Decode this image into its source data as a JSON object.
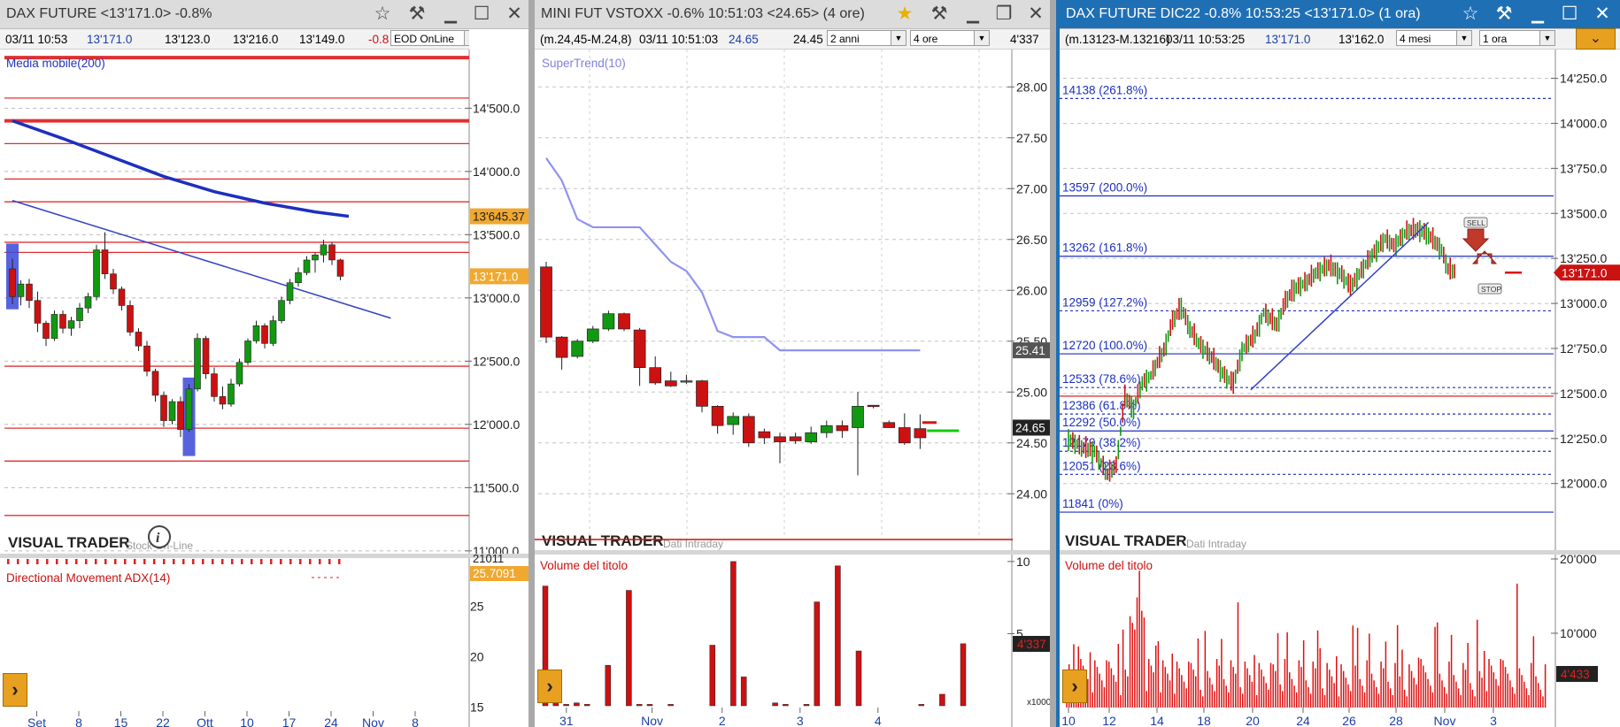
{
  "colors": {
    "up": "#119911",
    "down": "#cc1111",
    "ma": "#1d2fbf",
    "trend": "#3340c8",
    "supertrend": "#8f92f0",
    "fib": "#1d2fbf",
    "hline": "#e03030"
  },
  "panels": [
    {
      "title": "DAX FUTURE <13'171.0> -0.8%",
      "info": {
        "date": "03/11 10:53",
        "last": "13'171.0",
        "low": "13'123.0",
        "high": "13'216.0",
        "prev": "13'149.0",
        "change": "-0.8",
        "source": "EOD OnLine"
      },
      "indicator": "Media mobile(200)",
      "lower_indicator": "Directional Movement ADX(14)",
      "adx_value": "21011",
      "watermark": "VISUAL TRADER",
      "watermark_sub": "Stock On-Line",
      "price_labels": {
        "ma": "13'645.37",
        "last": "13'171.0",
        "adx": "25.7091"
      },
      "icons": [
        "star-icon",
        "tool-icon",
        "minimize-icon",
        "maximize-icon",
        "close-icon",
        "info-icon",
        "play-icon"
      ]
    },
    {
      "title": "MINI FUT VSTOXX -0.6% 10:51:03 <24.65> (4 ore)",
      "info": {
        "range": "(m.24,45-M.24,8)",
        "date": "03/11 10:51:03",
        "last": "24.65",
        "prev": "24.45",
        "period": "2 anni",
        "interval": "4 ore",
        "volume": "4'337"
      },
      "indicator": "SuperTrend(10)",
      "lower_indicator": "Volume del titolo",
      "watermark": "VISUAL TRADER",
      "watermark_sub": "Dati Intraday",
      "price_labels": {
        "st": "25.41",
        "last": "24.65",
        "vol": "4'337",
        "x1000": "x1000"
      },
      "icons": [
        "star-icon",
        "tool-icon",
        "minimize-icon",
        "restore-icon",
        "close-icon",
        "play-icon"
      ]
    },
    {
      "title": "DAX FUTURE DIC22 -0.8% 10:53:25 <13'171.0> (1 ora)",
      "info": {
        "range": "(m.13123-M.13216)",
        "date": "03/11 10:53:25",
        "last": "13'171.0",
        "prev": "13'162.0",
        "period": "4 mesi",
        "interval": "1 ora"
      },
      "lower_indicator": "Volume del titolo",
      "watermark": "VISUAL TRADER",
      "watermark_sub": "Dati Intraday",
      "price_labels": {
        "last": "13'171.0",
        "vol": "4'433"
      },
      "signals": {
        "sell": "SELL",
        "stop": "STOP"
      },
      "icons": [
        "star-icon",
        "tool-icon",
        "minimize-icon",
        "maximize-icon",
        "close-icon",
        "collapse-icon",
        "play-icon"
      ]
    }
  ],
  "chart_data": [
    {
      "type": "candlestick",
      "title": "DAX FUTURE <13'171.0> -0.8%",
      "ylim": [
        10950,
        14950
      ],
      "yticks": [
        "11'000.0",
        "11'500.0",
        "12'000.0",
        "12'500.0",
        "13'000.0",
        "13'500.0",
        "14'000.0",
        "14'500.0"
      ],
      "ytick_values": [
        11000,
        11500,
        12000,
        12500,
        13000,
        13500,
        14000,
        14500
      ],
      "xticks": [
        "Set",
        "8",
        "15",
        "22",
        "Ott",
        "10",
        "17",
        "24",
        "Nov",
        "8"
      ],
      "xtick_index": [
        5,
        10,
        15,
        20,
        25,
        30,
        35,
        40,
        45,
        50
      ],
      "candles": [
        [
          13230,
          13310,
          12950,
          13010
        ],
        [
          13010,
          13140,
          12940,
          13110
        ],
        [
          13110,
          13150,
          12920,
          12980
        ],
        [
          12980,
          13050,
          12730,
          12800
        ],
        [
          12800,
          12820,
          12620,
          12680
        ],
        [
          12680,
          12900,
          12660,
          12870
        ],
        [
          12870,
          12900,
          12720,
          12760
        ],
        [
          12760,
          12850,
          12700,
          12820
        ],
        [
          12820,
          12960,
          12760,
          12920
        ],
        [
          12920,
          13040,
          12880,
          13010
        ],
        [
          13010,
          13420,
          12980,
          13380
        ],
        [
          13380,
          13520,
          13150,
          13190
        ],
        [
          13190,
          13230,
          13030,
          13070
        ],
        [
          13070,
          13090,
          12900,
          12940
        ],
        [
          12940,
          12980,
          12700,
          12730
        ],
        [
          12730,
          12760,
          12580,
          12620
        ],
        [
          12620,
          12660,
          12380,
          12420
        ],
        [
          12420,
          12440,
          12180,
          12230
        ],
        [
          12230,
          12260,
          11980,
          12030
        ],
        [
          12030,
          12200,
          12000,
          12180
        ],
        [
          12180,
          12220,
          11900,
          11960
        ],
        [
          11960,
          12320,
          11940,
          12280
        ],
        [
          12280,
          12720,
          12260,
          12680
        ],
        [
          12680,
          12700,
          12360,
          12400
        ],
        [
          12400,
          12450,
          12180,
          12220
        ],
        [
          12220,
          12300,
          12120,
          12160
        ],
        [
          12160,
          12360,
          12140,
          12320
        ],
        [
          12320,
          12520,
          12300,
          12490
        ],
        [
          12490,
          12680,
          12470,
          12660
        ],
        [
          12660,
          12820,
          12640,
          12780
        ],
        [
          12780,
          12800,
          12600,
          12640
        ],
        [
          12640,
          12860,
          12620,
          12820
        ],
        [
          12820,
          13010,
          12800,
          12980
        ],
        [
          12980,
          13150,
          12950,
          13120
        ],
        [
          13120,
          13240,
          13090,
          13200
        ],
        [
          13200,
          13330,
          13180,
          13300
        ],
        [
          13300,
          13360,
          13200,
          13340
        ],
        [
          13340,
          13460,
          13280,
          13420
        ],
        [
          13420,
          13440,
          13260,
          13300
        ],
        [
          13300,
          13310,
          13140,
          13171
        ]
      ],
      "ma200": [
        [
          0,
          14400
        ],
        [
          6,
          14260
        ],
        [
          12,
          14110
        ],
        [
          18,
          13960
        ],
        [
          24,
          13840
        ],
        [
          30,
          13750
        ],
        [
          36,
          13680
        ],
        [
          40,
          13645.37
        ]
      ],
      "trendline": [
        [
          0,
          13770
        ],
        [
          45,
          12840
        ]
      ],
      "hlines": [
        14900,
        14580,
        14400,
        14220,
        13940,
        13760,
        13440,
        13360,
        12460,
        11970,
        11710,
        11280
      ],
      "hlines_thick": [
        14900,
        14400
      ],
      "highlight_boxes": [
        [
          0,
          13430,
          12910
        ],
        [
          21,
          12370,
          11750
        ]
      ],
      "adx": {
        "ylim": [
          13,
          29
        ],
        "yticks": [
          15,
          20,
          25
        ],
        "value": 25.7091
      }
    },
    {
      "type": "candlestick",
      "title": "MINI FUT VSTOXX 4 ore",
      "ylim": [
        23.55,
        28.35
      ],
      "yticks": [
        "24.00",
        "24.50",
        "25.00",
        "25.50",
        "26.00",
        "26.50",
        "27.00",
        "27.50",
        "28.00"
      ],
      "ytick_values": [
        24.0,
        24.5,
        25.0,
        25.5,
        26.0,
        26.5,
        27.0,
        27.5,
        28.0
      ],
      "xticks": [
        "31",
        "Nov",
        "2",
        "3",
        "4"
      ],
      "xtick_index": [
        3,
        8.5,
        13,
        18,
        23
      ],
      "candles": [
        [
          26.23,
          26.28,
          25.48,
          25.54
        ],
        [
          25.54,
          25.55,
          25.22,
          25.34
        ],
        [
          25.35,
          25.52,
          25.33,
          25.5
        ],
        [
          25.5,
          25.65,
          25.48,
          25.62
        ],
        [
          25.62,
          25.8,
          25.6,
          25.77
        ],
        [
          25.77,
          25.78,
          25.6,
          25.62
        ],
        [
          25.61,
          25.63,
          25.06,
          25.24
        ],
        [
          25.24,
          25.35,
          25.07,
          25.09
        ],
        [
          25.11,
          25.2,
          25.05,
          25.06
        ],
        [
          25.1,
          25.17,
          25.08,
          25.11
        ],
        [
          25.11,
          25.12,
          24.8,
          24.86
        ],
        [
          24.86,
          24.87,
          24.59,
          24.67
        ],
        [
          24.68,
          24.8,
          24.58,
          24.76
        ],
        [
          24.76,
          24.79,
          24.46,
          24.5
        ],
        [
          24.61,
          24.64,
          24.49,
          24.55
        ],
        [
          24.56,
          24.6,
          24.3,
          24.51
        ],
        [
          24.56,
          24.6,
          24.49,
          24.52
        ],
        [
          24.51,
          24.66,
          24.49,
          24.6
        ],
        [
          24.6,
          24.72,
          24.55,
          24.67
        ],
        [
          24.67,
          24.72,
          24.55,
          24.62
        ],
        [
          24.65,
          25.0,
          24.18,
          24.86
        ],
        [
          24.87,
          24.87,
          24.84,
          24.86
        ],
        [
          24.7,
          24.72,
          24.67,
          24.65
        ],
        [
          24.65,
          24.79,
          24.48,
          24.5
        ],
        [
          24.64,
          24.78,
          24.44,
          24.55
        ]
      ],
      "supertrend": [
        [
          0,
          27.3
        ],
        [
          1,
          27.08
        ],
        [
          2,
          26.7
        ],
        [
          3,
          26.62
        ],
        [
          5,
          26.62
        ],
        [
          6,
          26.62
        ],
        [
          7,
          26.45
        ],
        [
          8,
          26.28
        ],
        [
          9,
          26.19
        ],
        [
          10,
          25.98
        ],
        [
          11,
          25.6
        ],
        [
          12,
          25.54
        ],
        [
          14,
          25.54
        ],
        [
          15,
          25.41
        ],
        [
          24,
          25.41
        ]
      ],
      "stop_markers": [
        {
          "x": 24.6,
          "y": 24.7,
          "color": "#dd1111"
        },
        {
          "x": 24.9,
          "y": 24.62,
          "color": "#11cc11"
        }
      ],
      "volume": {
        "ylim": [
          0,
          10.3
        ],
        "yticks": [
          5,
          10
        ],
        "values": [
          8.3,
          0.6,
          0.1,
          0.2,
          0.1,
          0,
          2.8,
          0,
          8.0,
          0.1,
          0.1,
          0,
          0.1,
          0,
          0,
          0,
          4.2,
          0,
          10.0,
          2.0,
          0,
          0,
          0.2,
          0.1,
          0,
          0.1,
          7.2,
          0,
          9.7,
          0,
          3.8,
          0,
          0,
          0,
          0,
          0,
          0.1,
          0,
          0.8,
          0,
          4.3
        ]
      }
    },
    {
      "type": "line",
      "title": "DAX FUTURE DIC22 1 ora",
      "ylim": [
        11640,
        14400
      ],
      "yticks": [
        "12'000.0",
        "12'250.0",
        "12'500.0",
        "12'750.0",
        "13'000.0",
        "13'250.0",
        "13'500.0",
        "13'750.0",
        "14'000.0",
        "14'250.0"
      ],
      "ytick_values": [
        12000,
        12250,
        12500,
        12750,
        13000,
        13250,
        13500,
        13750,
        14000,
        14250
      ],
      "xticks": [
        "10",
        "12",
        "14",
        "18",
        "20",
        "24",
        "26",
        "28",
        "Nov",
        "3"
      ],
      "fib_levels": [
        {
          "label": "14138 (261.8%)",
          "value": 14138
        },
        {
          "label": "13597 (200.0%)",
          "value": 13597
        },
        {
          "label": "13262 (161.8%)",
          "value": 13262
        },
        {
          "label": "12959 (127.2%)",
          "value": 12959
        },
        {
          "label": "12720 (100.0%)",
          "value": 12720
        },
        {
          "label": "12533 (78.6%)",
          "value": 12533
        },
        {
          "label": "12386 (61.8%)",
          "value": 12386
        },
        {
          "label": "12292 (50.0%)",
          "value": 12292
        },
        {
          "label": "12179 (38.2%)",
          "value": 12179
        },
        {
          "label": "12051 (23.6%)",
          "value": 12051
        },
        {
          "label": "11841 (0%)",
          "value": 11841
        }
      ],
      "red_hline": 12485,
      "price_path": [
        [
          0,
          12250
        ],
        [
          6,
          12200
        ],
        [
          12,
          12180
        ],
        [
          18,
          12050
        ],
        [
          22,
          12100
        ],
        [
          26,
          12480
        ],
        [
          30,
          12420
        ],
        [
          34,
          12560
        ],
        [
          38,
          12600
        ],
        [
          44,
          12740
        ],
        [
          48,
          12900
        ],
        [
          52,
          12980
        ],
        [
          56,
          12860
        ],
        [
          60,
          12780
        ],
        [
          66,
          12700
        ],
        [
          72,
          12600
        ],
        [
          76,
          12550
        ],
        [
          80,
          12740
        ],
        [
          86,
          12820
        ],
        [
          90,
          12950
        ],
        [
          96,
          12880
        ],
        [
          100,
          13010
        ],
        [
          104,
          13080
        ],
        [
          110,
          13120
        ],
        [
          114,
          13170
        ],
        [
          120,
          13210
        ],
        [
          126,
          13160
        ],
        [
          130,
          13090
        ],
        [
          136,
          13200
        ],
        [
          140,
          13270
        ],
        [
          146,
          13360
        ],
        [
          150,
          13320
        ],
        [
          156,
          13400
        ],
        [
          162,
          13410
        ],
        [
          166,
          13380
        ],
        [
          172,
          13300
        ],
        [
          175,
          13190
        ],
        [
          179,
          13171
        ]
      ],
      "trendline": [
        [
          84,
          12520
        ],
        [
          166,
          13450
        ]
      ],
      "volume": {
        "ylim": [
          0,
          20000
        ],
        "yticks": [
          "10'000",
          "20'000"
        ]
      }
    }
  ]
}
